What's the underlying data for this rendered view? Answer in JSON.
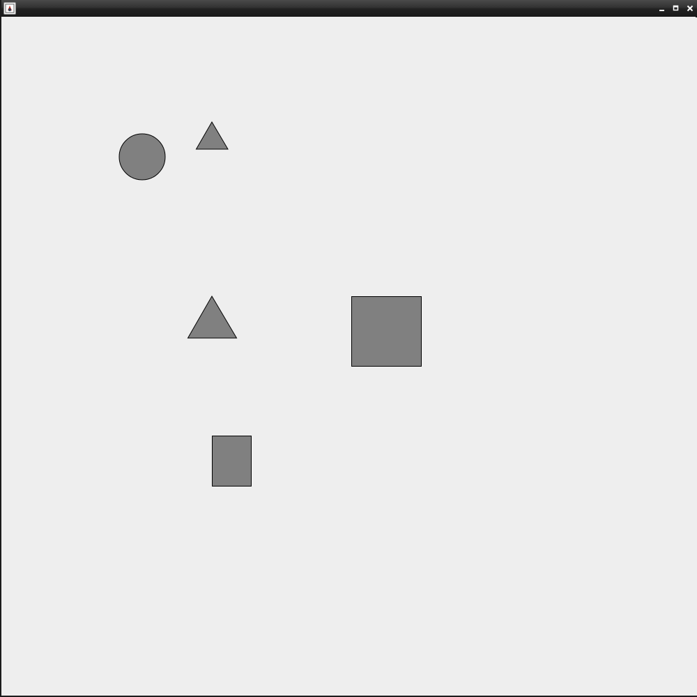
{
  "window": {
    "title": "",
    "controls": {
      "minimize_icon": "minimize-icon",
      "maximize_icon": "maximize-icon",
      "close_icon": "close-icon"
    },
    "app_icon": "java-app-icon"
  },
  "colors": {
    "shape_fill": "#808080",
    "shape_stroke": "#000000",
    "canvas_background": "#eeeeee"
  },
  "shapes": [
    {
      "kind": "circle",
      "name": "circle-shape"
    },
    {
      "kind": "triangle",
      "name": "small-triangle-shape"
    },
    {
      "kind": "triangle",
      "name": "large-triangle-shape"
    },
    {
      "kind": "square",
      "name": "square-shape"
    },
    {
      "kind": "rectangle",
      "name": "rectangle-shape"
    }
  ]
}
